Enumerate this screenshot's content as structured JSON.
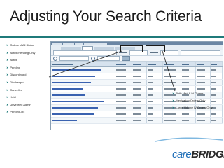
{
  "slide": {
    "title": "Adjusting Your Search Criteria"
  },
  "left_options": [
    "Orders of All Status",
    "Active/Pending Only",
    "Active",
    "Pending",
    "Discontinued",
    "Discharged",
    "Cancelled",
    "Held",
    "Unverified Admin",
    "Pending-Rx"
  ],
  "right_options": [
    "Both Med & IV Orders",
    "Medication Orders Only",
    "Large Volume IV Orders Only"
  ],
  "logo": {
    "part1": "care",
    "part2": "BRIDGE"
  },
  "colors": {
    "accent": "#1f7a7a",
    "logo_blue": "#1f6fb8",
    "link": "#3a62b0"
  }
}
